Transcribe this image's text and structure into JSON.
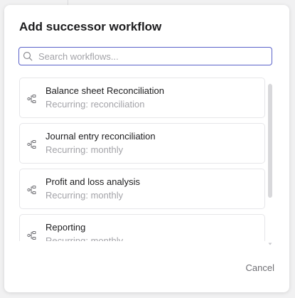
{
  "modal": {
    "title": "Add successor workflow",
    "search": {
      "placeholder": "Search workflows...",
      "value": "",
      "icon": "search-icon"
    },
    "workflows": [
      {
        "name": "Balance sheet Reconciliation",
        "subtitle": "Recurring: reconciliation",
        "icon": "workflow-icon"
      },
      {
        "name": "Journal entry reconciliation",
        "subtitle": "Recurring: monthly",
        "icon": "workflow-icon"
      },
      {
        "name": "Profit and loss analysis",
        "subtitle": "Recurring: monthly",
        "icon": "workflow-icon"
      },
      {
        "name": "Reporting",
        "subtitle": "Recurring: monthly",
        "icon": "workflow-icon"
      }
    ],
    "cancel_label": "Cancel"
  },
  "colors": {
    "accent_border": "#5a62c9",
    "muted_text": "#a3a3a8",
    "title_text": "#1c1c1e"
  }
}
